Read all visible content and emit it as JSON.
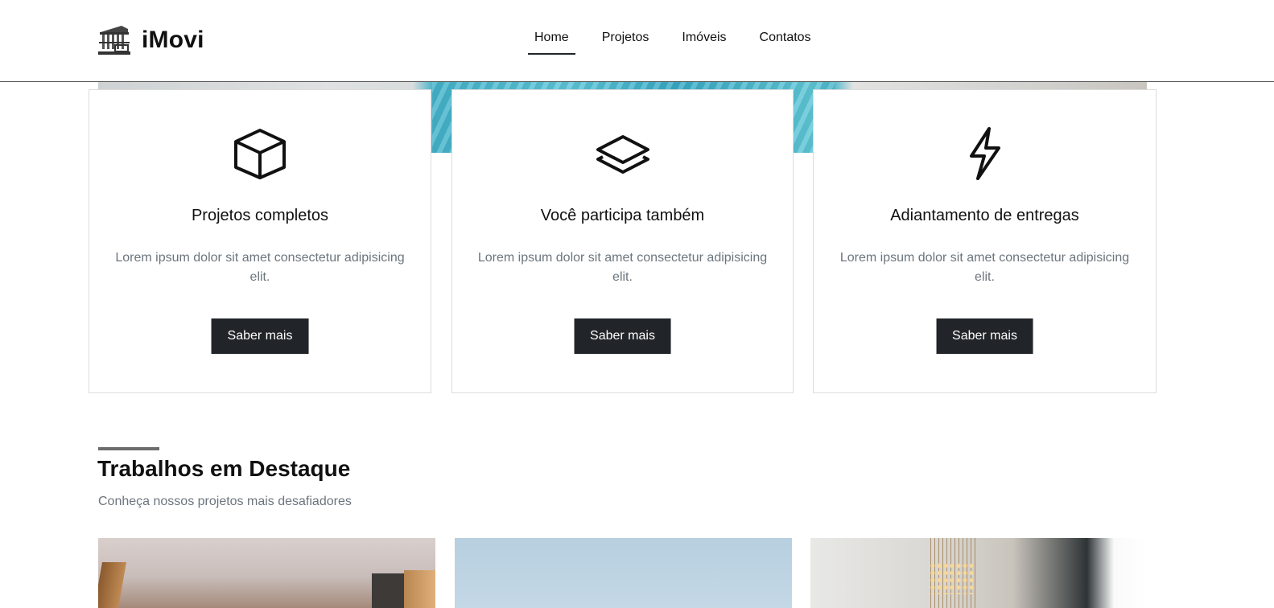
{
  "header": {
    "brand_name": "iMovi",
    "nav": [
      {
        "label": "Home",
        "active": true
      },
      {
        "label": "Projetos",
        "active": false
      },
      {
        "label": "Imóveis",
        "active": false
      },
      {
        "label": "Contatos",
        "active": false
      }
    ]
  },
  "features": [
    {
      "icon": "box-icon",
      "title": "Projetos completos",
      "text": "Lorem ipsum dolor sit amet consectetur adipisicing elit.",
      "button": "Saber mais"
    },
    {
      "icon": "layers-icon",
      "title": "Você participa também",
      "text": "Lorem ipsum dolor sit amet consectetur adipisicing elit.",
      "button": "Saber mais"
    },
    {
      "icon": "lightning-icon",
      "title": "Adiantamento de entregas",
      "text": "Lorem ipsum dolor sit amet consectetur adipisicing elit.",
      "button": "Saber mais"
    }
  ],
  "featured": {
    "title": "Trabalhos em Destaque",
    "subtitle": "Conheça nossos projetos mais desafiadores"
  },
  "colors": {
    "button_bg": "#212529",
    "muted_text": "#6c757d",
    "accent_water": "#43b2c9"
  }
}
